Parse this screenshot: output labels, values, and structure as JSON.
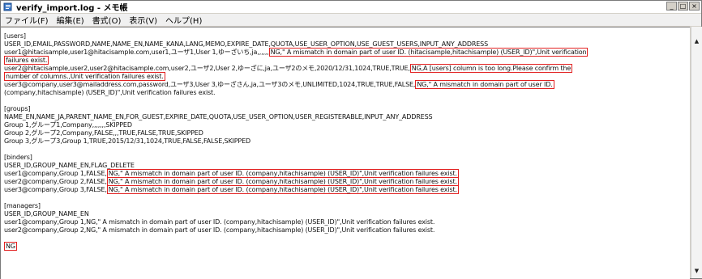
{
  "window": {
    "title": "verify_import.log - メモ帳",
    "controls": {
      "minimize": "_",
      "maximize": "□",
      "close": "×"
    }
  },
  "menu": [
    "ファイル(F)",
    "編集(E)",
    "書式(O)",
    "表示(V)",
    "ヘルプ(H)"
  ],
  "colors": {
    "highlight": "#e22222"
  },
  "icons": {
    "app": "notepad-icon",
    "scroll_up": "up-arrow-icon",
    "scroll_down": "down-arrow-icon"
  },
  "log": {
    "users": {
      "header": "[users]",
      "columns": "USER_ID,EMAIL,PASSWORD,NAME,NAME_EN,NAME_KANA,LANG,MEMO,EXPIRE_DATE,QUOTA,USE_USER_OPTION,USE_GUEST_USERS,INPUT_ANY_ADDRESS",
      "row1_data": "user1@hitacisample,user1@hitacisample.com,user1,ユーザ1,User 1,ゆーざいち,ja,,,,,,",
      "row1_err_a": "NG,\" A mismatch in domain part of user ID. (hitacisample,hitachisample) (USER_ID)\",Unit verification",
      "row1_err_b": "failures exist.",
      "row2_data": "user2@hitacisample,user2,user2@hitacisample.com,user2,ユーザ2,User 2,ゆーざに,ja,ユーザ2のメモ,2020/12/31,1024,TRUE,TRUE,",
      "row2_err_a": "NG,A [users] column is too long.Please confirm the",
      "row2_err_b": "number of columns.,Unit verification failures exist.",
      "row3_data": "user3@company,user3@mailaddress.com,password,ユーザ3,User 3,ゆーざさん,ja,ユーザ3のメモ,UNLIMITED,1024,TRUE,TRUE,FALSE,",
      "row3_err_a": "NG,\" A mismatch in domain part of user ID.",
      "row3_err_b": "(company,hitachisample) (USER_ID)\",Unit verification failures exist."
    },
    "groups": {
      "header": "[groups]",
      "columns": "NAME_EN,NAME_JA,PARENT_NAME_EN,FOR_GUEST,EXPIRE_DATE,QUOTA,USE_USER_OPTION,USER_REGISTERABLE,INPUT_ANY_ADDRESS",
      "row1": "Group 1,グループ1,Company,,,,,,,SKIPPED",
      "row2": "Group 2,グループ2,Company,FALSE,,,TRUE,FALSE,TRUE,SKIPPED",
      "row3": "Group 3,グループ3,Group 1,TRUE,2015/12/31,1024,TRUE,FALSE,FALSE,SKIPPED"
    },
    "binders": {
      "header": "[binders]",
      "columns": "USER_ID,GROUP_NAME_EN,FLAG_DELETE",
      "row1_data": "user1@company,Group 1,FALSE,",
      "row2_data": "user2@company,Group 2,FALSE,",
      "row3_data": "user3@company,Group 3,FALSE,",
      "err": "NG,\" A mismatch in domain part of user ID. (company,hitachisample) (USER_ID)\",Unit verification failures exist."
    },
    "managers": {
      "header": "[managers]",
      "columns": "USER_ID,GROUP_NAME_EN",
      "row1": "user1@company,Group 1,NG,\" A mismatch in domain part of user ID. (company,hitachisample) (USER_ID)\",Unit verification failures exist.",
      "row2": "user2@company,Group 2,NG,\" A mismatch in domain part of user ID. (company,hitachisample) (USER_ID)\",Unit verification failures exist."
    },
    "result": "NG"
  }
}
